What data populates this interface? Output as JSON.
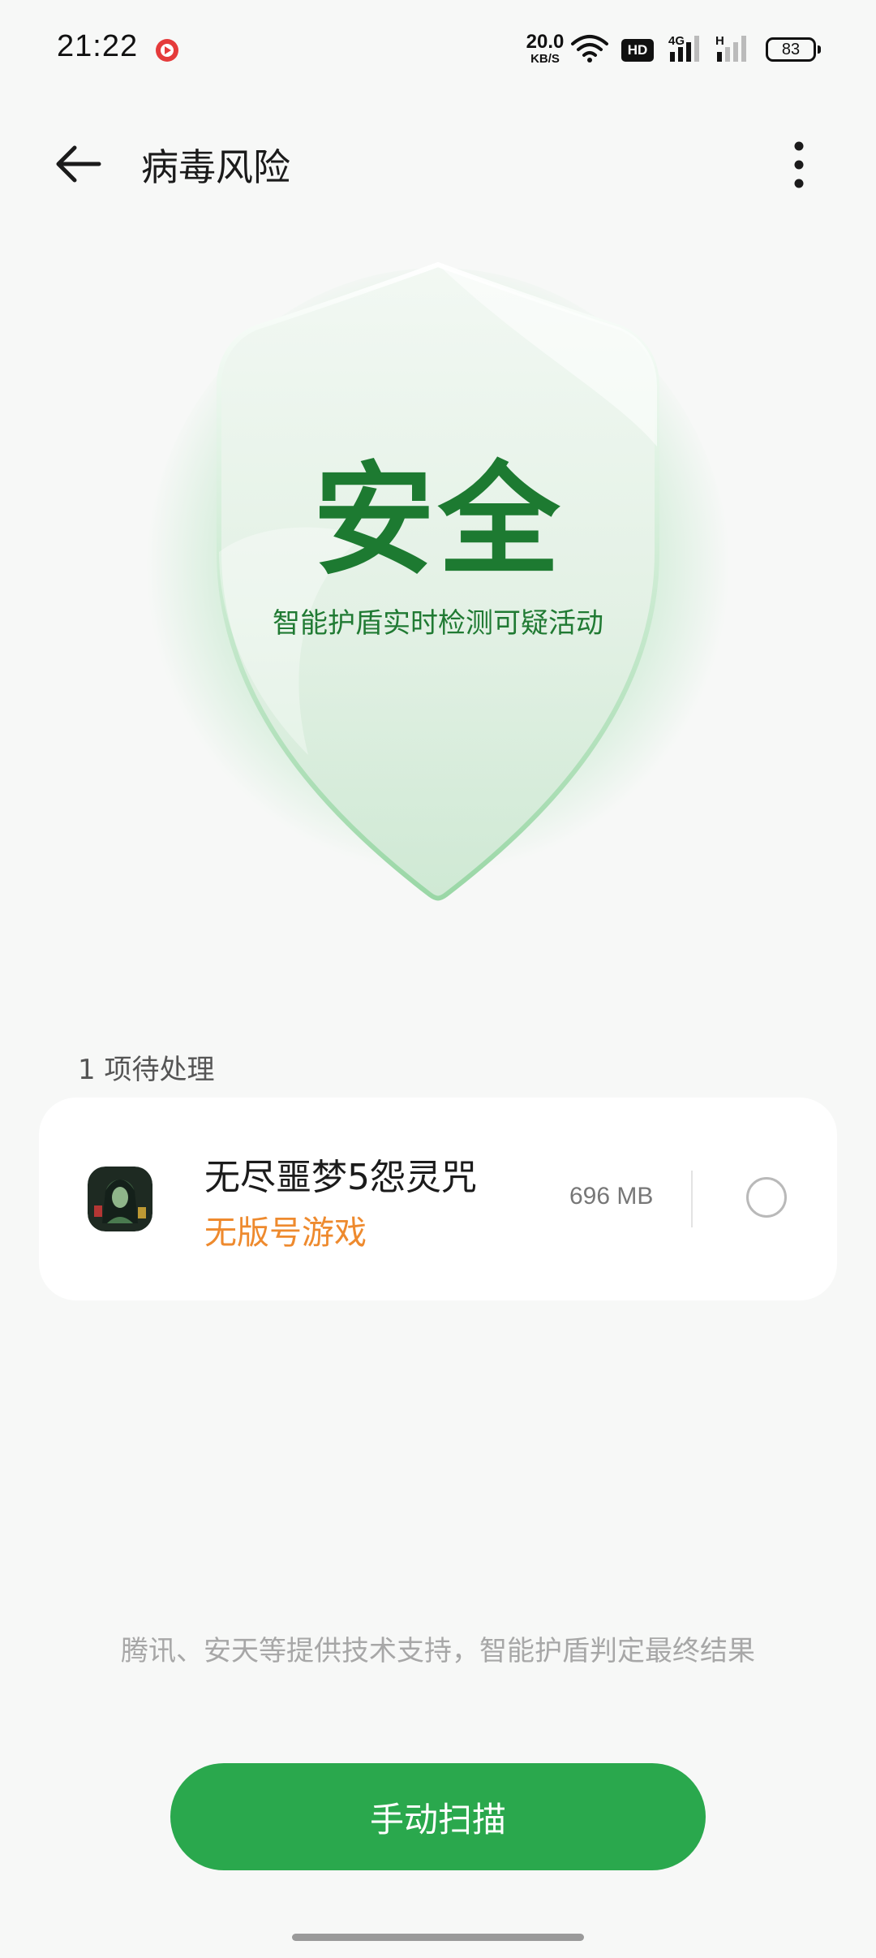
{
  "status_bar": {
    "time": "21:22",
    "net_speed_value": "20.0",
    "net_speed_unit": "KB/S",
    "hd_label": "HD",
    "network_type": "4G",
    "signal2_label": "H",
    "battery": "83"
  },
  "header": {
    "title": "病毒风险"
  },
  "shield": {
    "status": "安全",
    "subtitle": "智能护盾实时检测可疑活动",
    "colors": {
      "text": "#1d7a31",
      "glow": "#3fbf5e"
    }
  },
  "pending": {
    "label": "1 项待处理",
    "items": [
      {
        "name": "无尽噩梦5怨灵咒",
        "tag": "无版号游戏",
        "size": "696 MB",
        "checked": false
      }
    ]
  },
  "footer": {
    "note": "腾讯、安天等提供技术支持，智能护盾判定最终结果",
    "scan_button": "手动扫描",
    "accent_color": "#2aa84d",
    "warning_color": "#ee8a2e"
  }
}
